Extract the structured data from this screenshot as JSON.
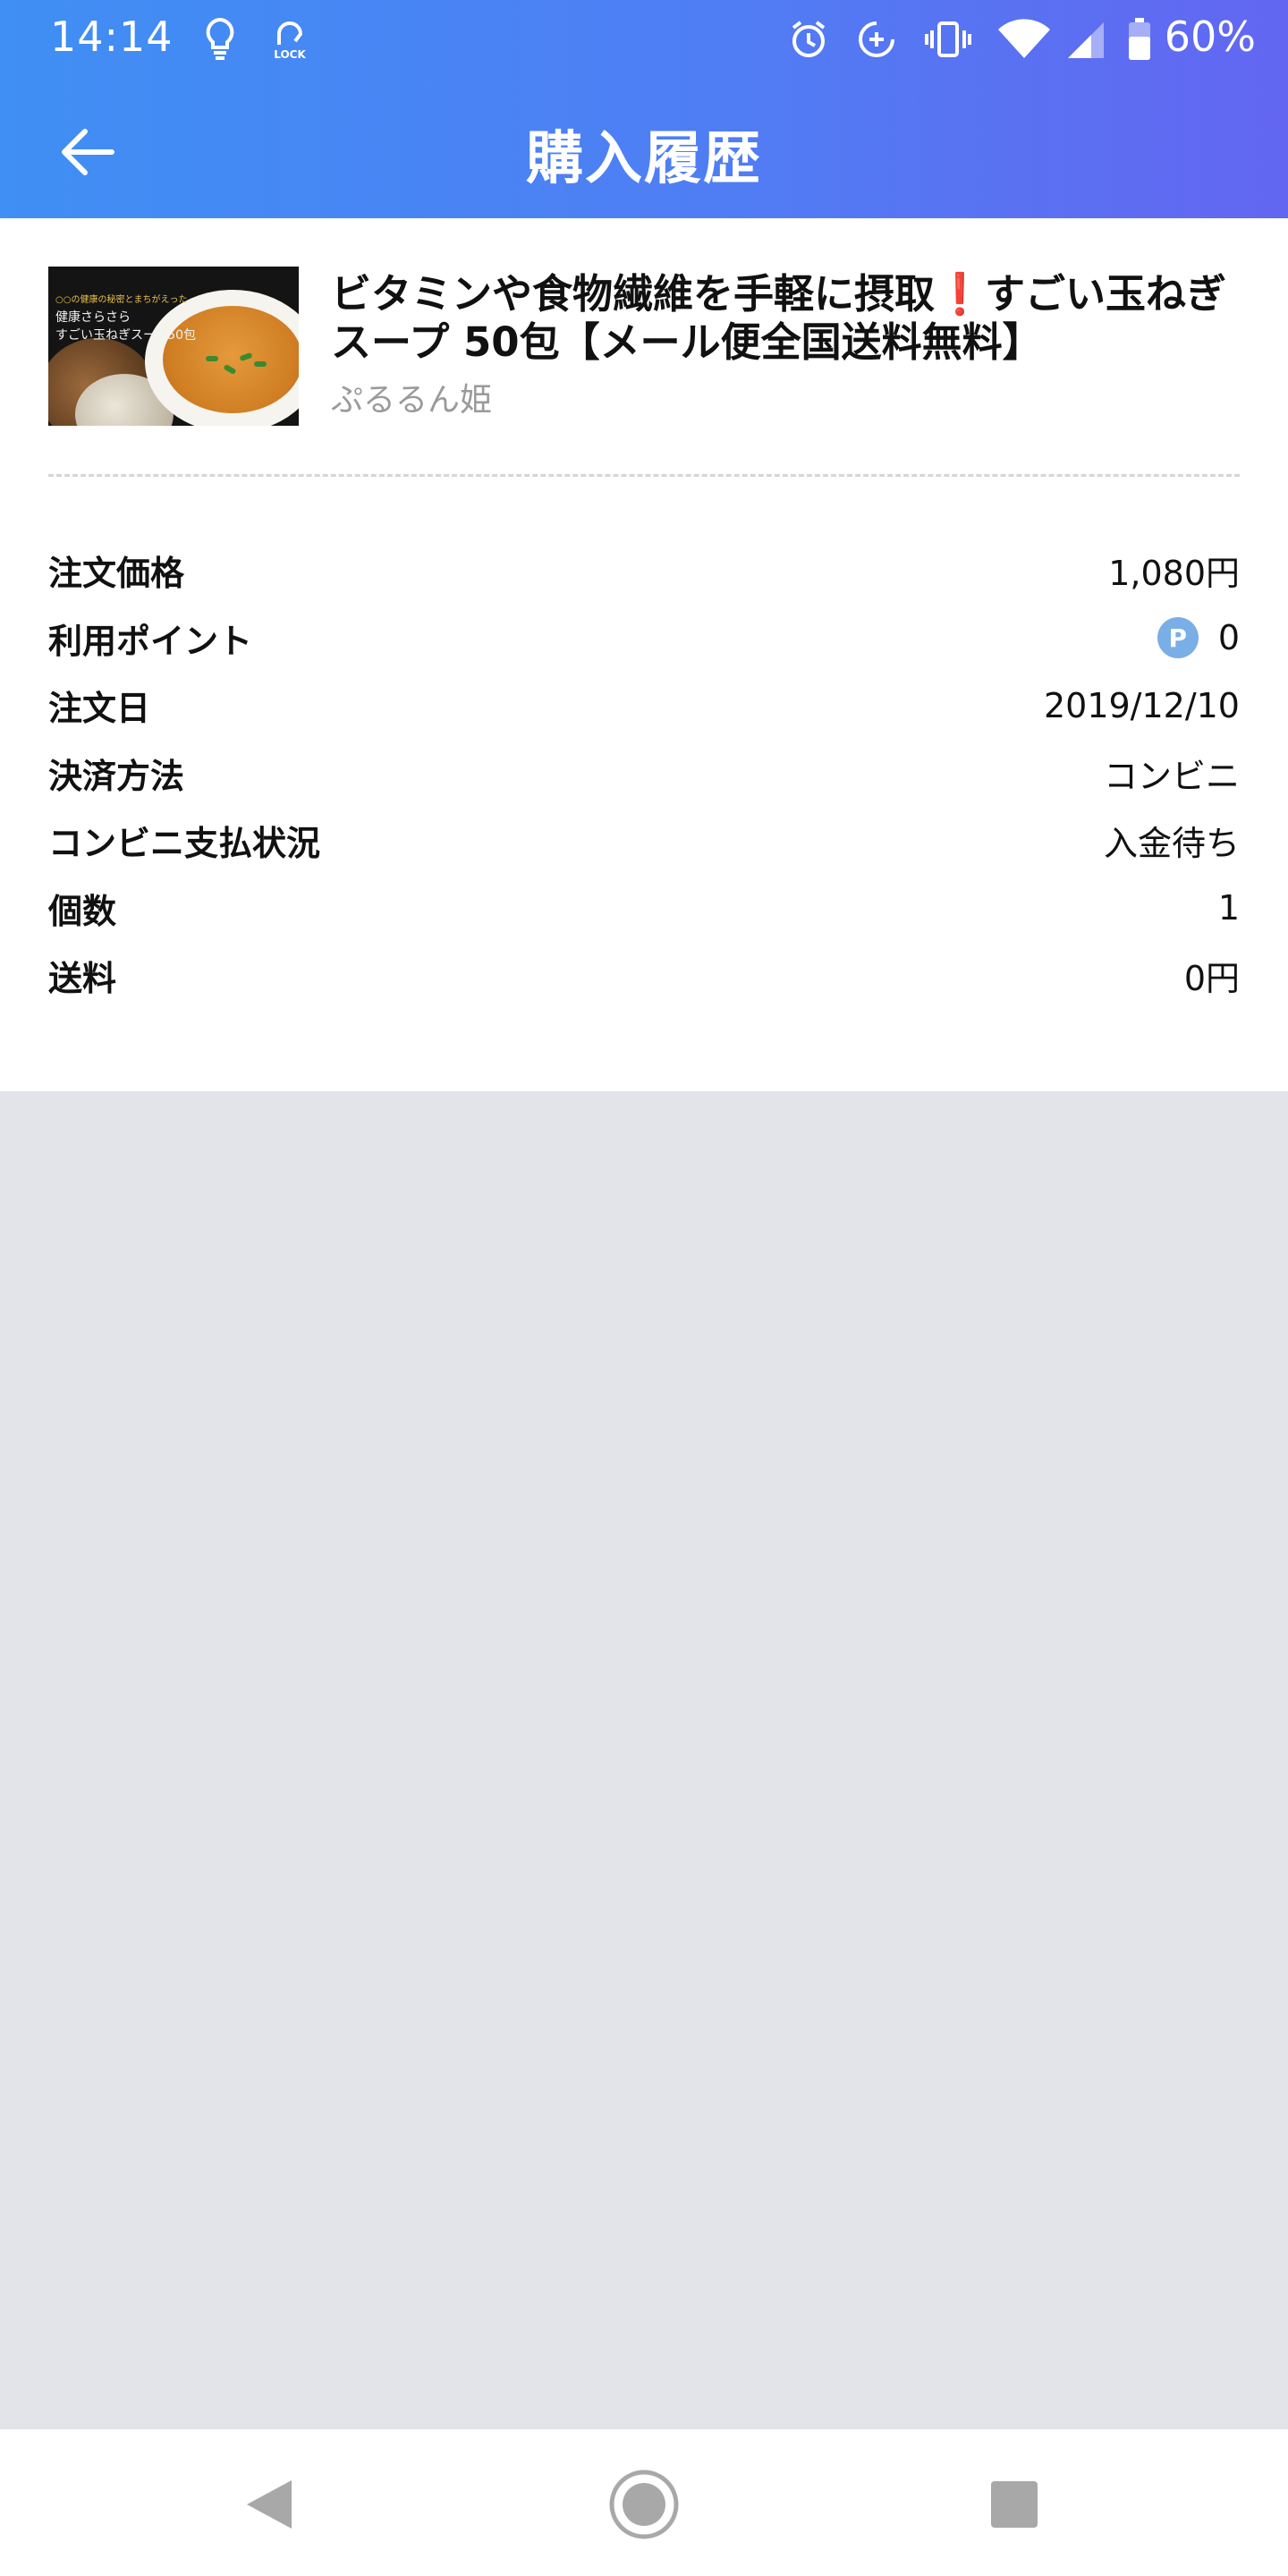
{
  "status_bar": {
    "time": "14:14",
    "battery": "60%",
    "icons": [
      "lightbulb-icon",
      "lock-icon",
      "alarm-icon",
      "data-saver-icon",
      "vibrate-icon",
      "wifi-icon",
      "signal-icon",
      "battery-icon"
    ],
    "lock_label": "LOCK"
  },
  "app_bar": {
    "title": "購入履歴",
    "back_icon": "arrow-left-icon"
  },
  "product": {
    "title_part1": "ビタミンや食物繊維を手軽に摂取",
    "title_excl": "❗",
    "title_part2": "すごい玉ねぎスープ 50包【メール便全国送料無料】",
    "shop": "ぷるるん姫",
    "thumb_text_1": "○○の健康の秘密とまちがえった",
    "thumb_text_2": "健康さらさら",
    "thumb_text_3": "すごい玉ねぎスープ50包"
  },
  "details": [
    {
      "label": "注文価格",
      "value": "1,080円"
    },
    {
      "label": "利用ポイント",
      "value": "0",
      "icon": "P"
    },
    {
      "label": "注文日",
      "value": "2019/12/10"
    },
    {
      "label": "決済方法",
      "value": "コンビニ"
    },
    {
      "label": "コンビニ支払状況",
      "value": "入金待ち"
    },
    {
      "label": "個数",
      "value": "1"
    },
    {
      "label": "送料",
      "value": "0円"
    }
  ],
  "nav_bar": {
    "icons": [
      "back-triangle-icon",
      "home-circle-icon",
      "recents-square-icon"
    ]
  },
  "colors": {
    "header_start": "#3f8ff4",
    "header_end": "#6366f1",
    "background": "#e3e4ea",
    "point_badge": "#7aaee6",
    "exclamation": "#e0242f"
  }
}
